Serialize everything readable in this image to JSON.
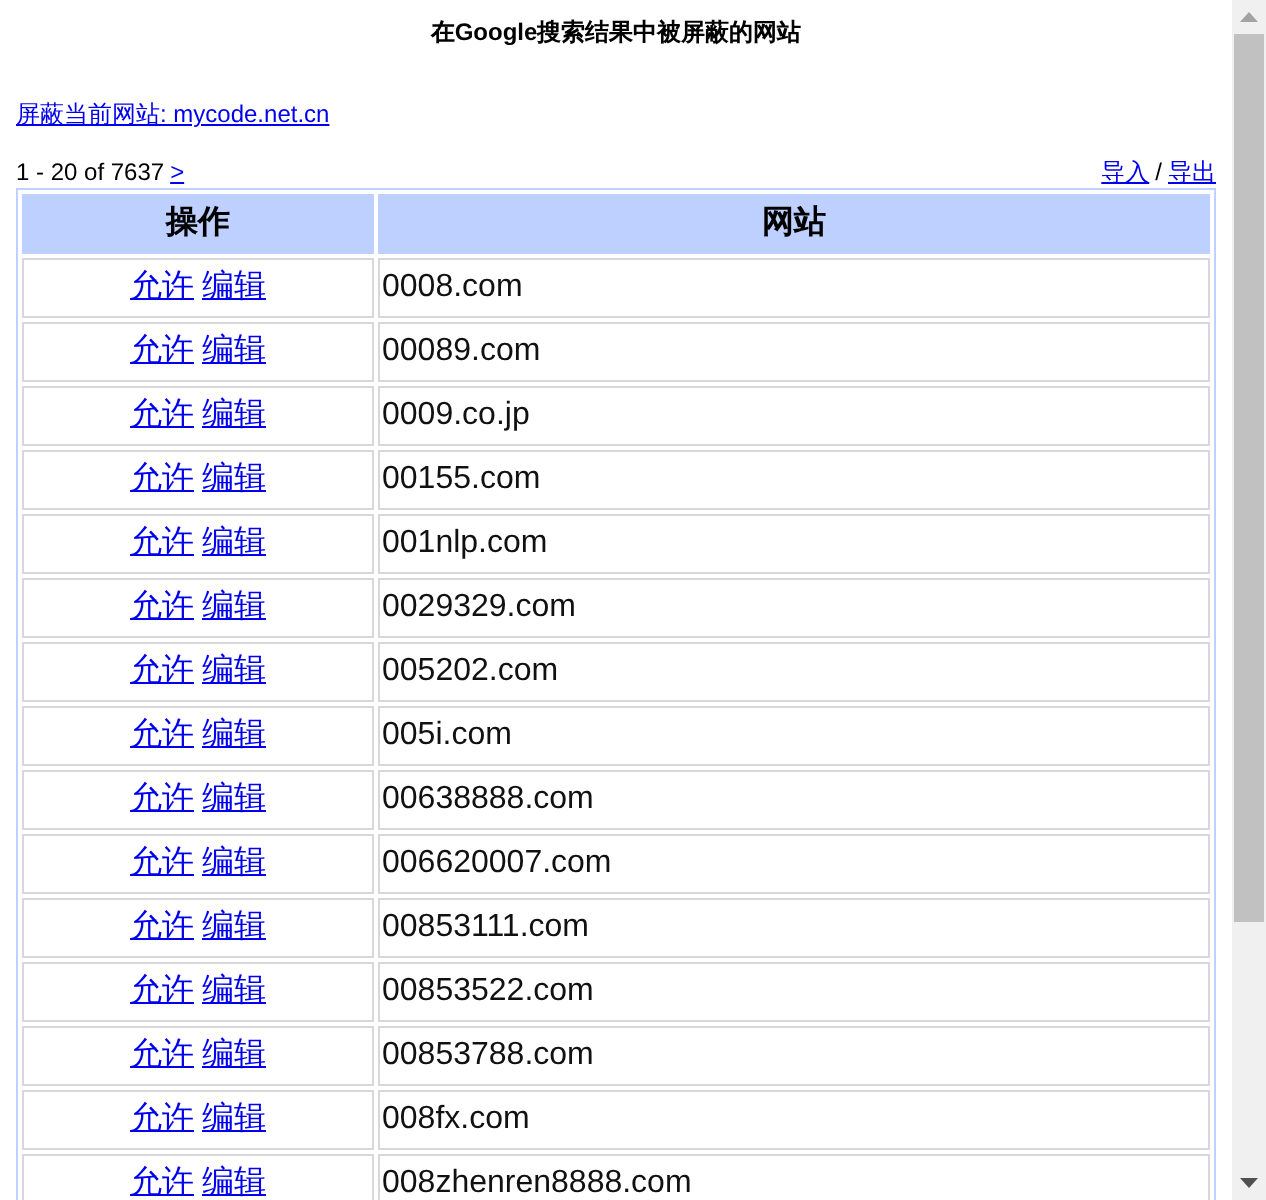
{
  "title": "在Google搜索结果中被屏蔽的网站",
  "block_link": "屏蔽当前网站: mycode.net.cn",
  "pager": {
    "range": "1 - 20 of 7637",
    "next": ">"
  },
  "actions": [
    {
      "label": "导入"
    },
    {
      "label": "/"
    },
    {
      "label": "导出"
    }
  ],
  "table": {
    "columns": [
      "操作",
      "网站"
    ],
    "rows": [
      {
        "actions": [
          "允许",
          "编辑"
        ],
        "site": "0008.com"
      },
      {
        "actions": [
          "允许",
          "编辑"
        ],
        "site": "00089.com"
      },
      {
        "actions": [
          "允许",
          "编辑"
        ],
        "site": "0009.co.jp"
      },
      {
        "actions": [
          "允许",
          "编辑"
        ],
        "site": "00155.com"
      },
      {
        "actions": [
          "允许",
          "编辑"
        ],
        "site": "001nlp.com"
      },
      {
        "actions": [
          "允许",
          "编辑"
        ],
        "site": "0029329.com"
      },
      {
        "actions": [
          "允许",
          "编辑"
        ],
        "site": "005202.com"
      },
      {
        "actions": [
          "允许",
          "编辑"
        ],
        "site": "005i.com"
      },
      {
        "actions": [
          "允许",
          "编辑"
        ],
        "site": "00638888.com"
      },
      {
        "actions": [
          "允许",
          "编辑"
        ],
        "site": "006620007.com"
      },
      {
        "actions": [
          "允许",
          "编辑"
        ],
        "site": "00853111.com"
      },
      {
        "actions": [
          "允许",
          "编辑"
        ],
        "site": "00853522.com"
      },
      {
        "actions": [
          "允许",
          "编辑"
        ],
        "site": "00853788.com"
      },
      {
        "actions": [
          "允许",
          "编辑"
        ],
        "site": "008fx.com"
      },
      {
        "actions": [
          "允许",
          "编辑"
        ],
        "site": "008zhenren8888.com"
      }
    ]
  }
}
